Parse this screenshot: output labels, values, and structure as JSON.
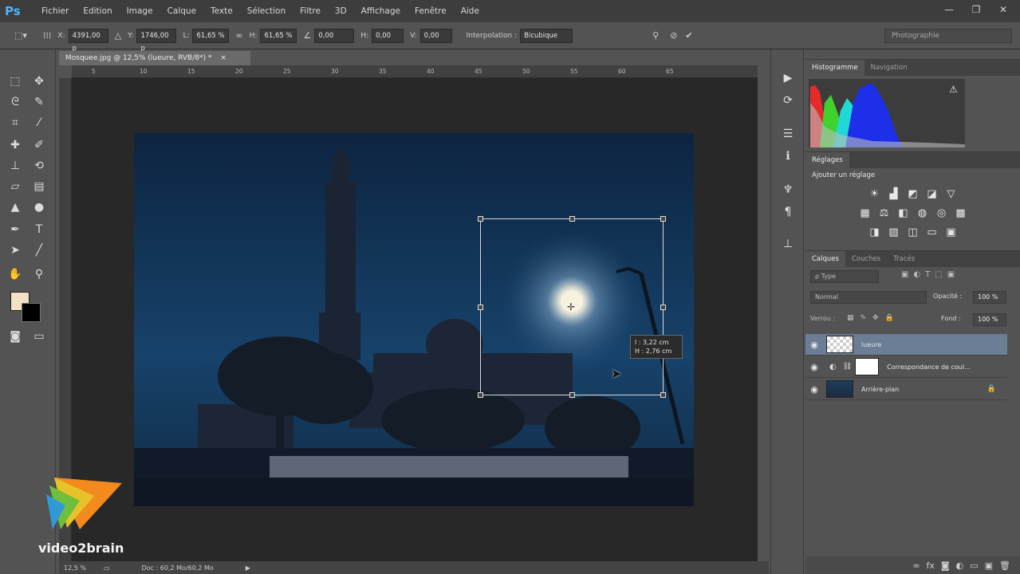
{
  "app": {
    "logo": "Ps"
  },
  "menu": [
    "Fichier",
    "Edition",
    "Image",
    "Calque",
    "Texte",
    "Sélection",
    "Filtre",
    "3D",
    "Affichage",
    "Fenêtre",
    "Aide"
  ],
  "window_controls": {
    "minimize": "—",
    "restore": "❐",
    "close": "✕"
  },
  "options": {
    "x_label": "X:",
    "x_value": "4391,00 p",
    "y_label": "Y:",
    "y_value": "1746,00 p",
    "l_label": "L:",
    "l_value": "61,65 %",
    "h_label": "H:",
    "h_value": "61,65 %",
    "angle_value": "0,00",
    "hskew_label": "H:",
    "hskew_value": "0,00",
    "vskew_label": "V:",
    "vskew_value": "0,00",
    "interp_label": "Interpolation :",
    "interp_value": "Bicubique",
    "workspace": "Photographie"
  },
  "document": {
    "tab_title": "Mosquee.jpg @ 12,5% (lueure, RVB/8*) *",
    "zoom": "12,5 %",
    "doc_info": "Doc : 60,2 Mo/60,2 Mo",
    "ruler_ticks": [
      "5",
      "10",
      "15",
      "20",
      "25",
      "30",
      "35",
      "40",
      "45",
      "50",
      "55",
      "60",
      "65"
    ],
    "transform_tooltip": {
      "width": "l : 3,22 cm",
      "height": "H : 2,76 cm"
    }
  },
  "colors": {
    "foreground": "#f2e2c4",
    "background": "#000000",
    "selected_layer": "#6c7d96"
  },
  "panels": {
    "histogram": {
      "tabs": [
        "Histogramme",
        "Navigation"
      ],
      "warning_icon": "⚠"
    },
    "adjustments": {
      "tabs": [
        "Réglages"
      ],
      "heading": "Ajouter un réglage"
    },
    "layers": {
      "tabs": [
        "Calques",
        "Couches",
        "Tracés"
      ],
      "kind_filter": "ρ Type",
      "blend_mode": "Normal",
      "opacity_label": "Opacité :",
      "opacity_value": "100 %",
      "lock_label": "Verrou :",
      "fill_label": "Fond :",
      "fill_value": "100 %",
      "items": [
        {
          "name": "lueure",
          "selected": true
        },
        {
          "name": "Correspondance de coul...",
          "selected": false
        },
        {
          "name": "Arrière-plan",
          "selected": false
        }
      ]
    }
  },
  "watermark": {
    "text": "video2brain"
  }
}
